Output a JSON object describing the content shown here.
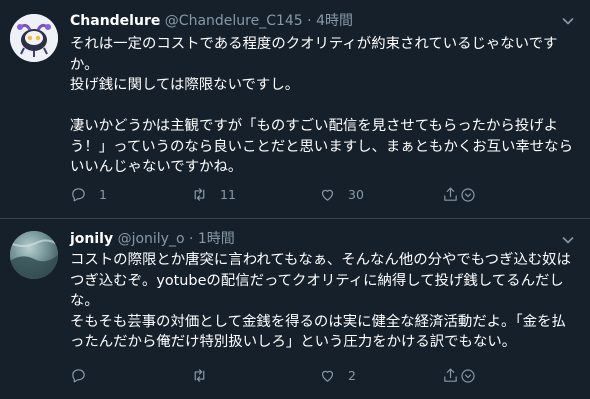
{
  "colors": {
    "background": "#15202b",
    "divider": "#38444d",
    "text": "#ffffff",
    "muted": "#8899a6"
  },
  "tweets": [
    {
      "display_name": "Chandelure",
      "handle": "@Chandelure_C145",
      "separator": "·",
      "time": "4時間",
      "text": "それは一定のコストである程度のクオリティが約束されているじゃないですか。\n投げ銭に関しては際限ないですし。\n\n凄いかどうかは主観ですが「ものすごい配信を見させてもらったから投げよう！」っていうのなら良いことだと思いますし、まぁともかくお互い幸せならいいんじゃないですかね。",
      "reply_count": "1",
      "retweet_count": "11",
      "like_count": "30",
      "icons": [
        "avatar",
        "caret-down-icon",
        "reply-icon",
        "retweet-icon",
        "like-icon",
        "share-icon"
      ]
    },
    {
      "display_name": "jonily",
      "handle": "@jonily_o",
      "separator": "·",
      "time": "1時間",
      "text": "コストの際限とか唐突に言われてもなぁ、そんなん他の分やでもつぎ込む奴はつぎ込むぞ。yotubeの配信だってクオリティに納得して投げ銭してるんだしな。\nそもそも芸事の対価として金銭を得るのは実に健全な経済活動だよ。「金を払ったんだから俺だけ特別扱いしろ」という圧力をかける訳でもない。",
      "reply_count": "",
      "retweet_count": "",
      "like_count": "2",
      "icons": [
        "avatar",
        "caret-down-icon",
        "reply-icon",
        "retweet-icon",
        "like-icon",
        "share-icon"
      ]
    }
  ]
}
